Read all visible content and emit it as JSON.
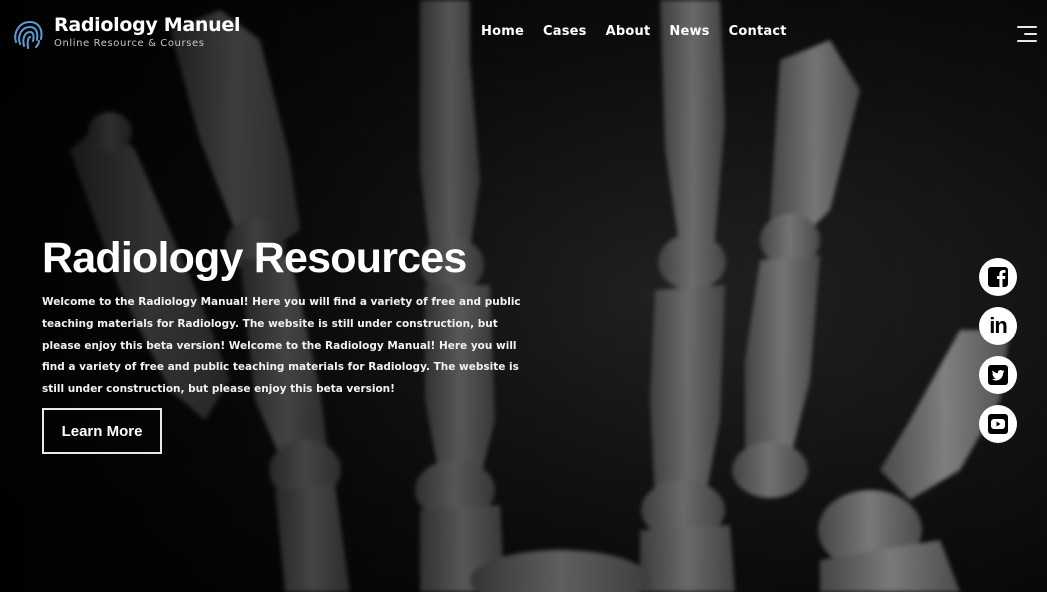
{
  "site": {
    "brand": "Radiology Manuel",
    "tagline": "Online Resource & Courses"
  },
  "nav": {
    "items": [
      "Home",
      "Cases",
      "About",
      "News",
      "Contact"
    ]
  },
  "hero": {
    "title": "Radiology Resources",
    "text": "Welcome to the Radiology Manual! Here you will find a variety of free and public teaching materials for Radiology. The website is still under construction, but please enjoy this beta version! Welcome to the Radiology Manual! Here you will find a variety of free and public teaching materials for Radiology. The website is still under construction, but please enjoy this beta version!",
    "button_label": "Learn More"
  },
  "social": {
    "icons": [
      "facebook-icon",
      "linkedin-icon",
      "twitter-icon",
      "youtube-icon"
    ],
    "linkedin_label": "in"
  },
  "colors": {
    "background": "#050505",
    "bone": "#9a9a9a",
    "text": "#ffffff",
    "logo_accent": "#5a9fd4"
  }
}
